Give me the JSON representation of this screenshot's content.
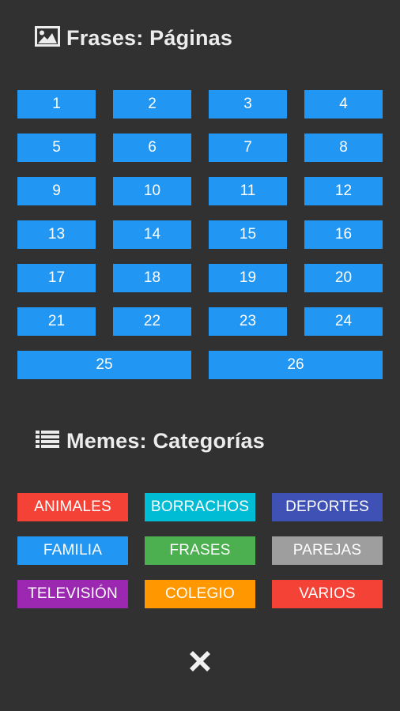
{
  "pages_section": {
    "title": "Frases: Páginas",
    "icon": "image-icon",
    "pages": [
      "1",
      "2",
      "3",
      "4",
      "5",
      "6",
      "7",
      "8",
      "9",
      "10",
      "11",
      "12",
      "13",
      "14",
      "15",
      "16",
      "17",
      "18",
      "19",
      "20",
      "21",
      "22",
      "23",
      "24",
      "25",
      "26"
    ]
  },
  "memes_section": {
    "title": "Memes: Categorías",
    "icon": "list-icon",
    "categories": [
      {
        "label": "ANIMALES",
        "color": "#f44336"
      },
      {
        "label": "BORRACHOS",
        "color": "#00bcd4"
      },
      {
        "label": "DEPORTES",
        "color": "#3f51b5"
      },
      {
        "label": "FAMILIA",
        "color": "#2196f3"
      },
      {
        "label": "FRASES",
        "color": "#4caf50"
      },
      {
        "label": "PAREJAS",
        "color": "#9e9e9e"
      },
      {
        "label": "TELEVISIÓN",
        "color": "#9c27b0"
      },
      {
        "label": "COLEGIO",
        "color": "#ff9800"
      },
      {
        "label": "VARIOS",
        "color": "#f44336"
      }
    ]
  },
  "close": {
    "icon": "close-icon"
  },
  "theme": {
    "background": "#313131",
    "page_button": "#2196f3",
    "header_text": "#ececec"
  }
}
